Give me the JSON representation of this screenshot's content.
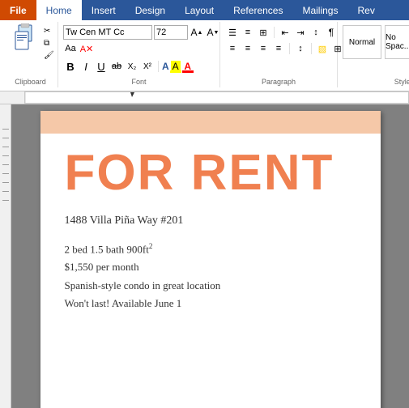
{
  "tabs": {
    "items": [
      {
        "label": "File",
        "type": "file"
      },
      {
        "label": "Home",
        "type": "active"
      },
      {
        "label": "Insert",
        "type": "normal"
      },
      {
        "label": "Design",
        "type": "normal"
      },
      {
        "label": "Layout",
        "type": "normal"
      },
      {
        "label": "References",
        "type": "normal"
      },
      {
        "label": "Mailings",
        "type": "normal"
      },
      {
        "label": "Rev",
        "type": "normal"
      }
    ]
  },
  "ribbon": {
    "groups": {
      "clipboard": {
        "label": "Clipboard"
      },
      "font": {
        "label": "Font",
        "font_name": "Tw Cen MT Cc",
        "font_size": "72",
        "bold": "B",
        "italic": "I",
        "underline": "U",
        "strikethrough": "ab",
        "subscript": "X₂",
        "superscript": "X²"
      },
      "paragraph": {
        "label": "Paragraph"
      },
      "styles": {
        "label": "Styles"
      }
    }
  },
  "document": {
    "banner_color": "#f5c8a8",
    "title": "FOR RENT",
    "title_color": "#f08050",
    "address": "1488 Villa Piña Way #201",
    "details": [
      "2 bed 1.5 bath 900ft²",
      "$1,550 per month",
      "Spanish-style condo in great location",
      "Won't last! Available June 1"
    ]
  }
}
